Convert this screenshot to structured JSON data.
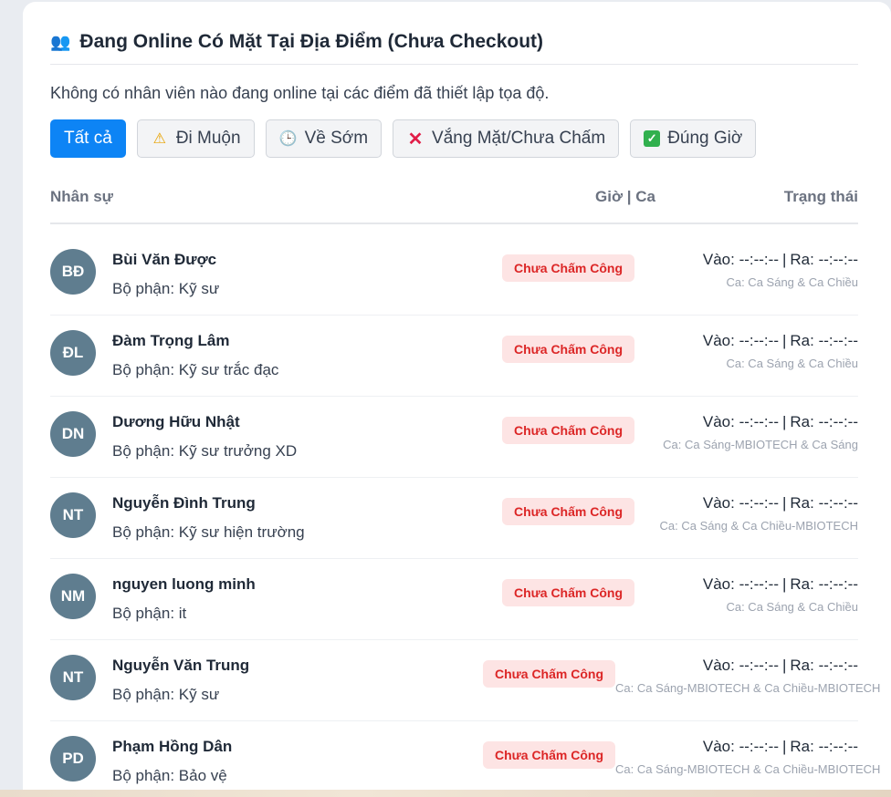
{
  "header": {
    "icon": "people-icon",
    "title": "Đang Online Có Mặt Tại Địa Điểm (Chưa Checkout)"
  },
  "empty_message": "Không có nhân viên nào đang online tại các điểm đã thiết lập tọa độ.",
  "filters": [
    {
      "label": "Tất cả",
      "icon": "",
      "active": true
    },
    {
      "label": "Đi Muộn",
      "icon": "warning-icon",
      "active": false
    },
    {
      "label": "Về Sớm",
      "icon": "clock-icon",
      "active": false
    },
    {
      "label": "Vắng Mặt/Chưa Chấm",
      "icon": "cross-icon",
      "active": false
    },
    {
      "label": "Đúng Giờ",
      "icon": "check-icon",
      "active": false
    }
  ],
  "table": {
    "headers": {
      "name": "Nhân sự",
      "time": "Giờ | Ca",
      "status": "Trạng thái"
    },
    "rows": [
      {
        "initials": "BĐ",
        "name": "Bùi Văn Được",
        "dept": "Bộ phận: Kỹ sư",
        "status": "Chưa Chấm Công",
        "in": "Vào: --:--:--",
        "out": "Ra: --:--:--",
        "shift": "Ca: Ca Sáng & Ca Chiều"
      },
      {
        "initials": "ĐL",
        "name": "Đàm Trọng Lâm",
        "dept": "Bộ phận: Kỹ sư trắc đạc",
        "status": "Chưa Chấm Công",
        "in": "Vào: --:--:--",
        "out": "Ra: --:--:--",
        "shift": "Ca: Ca Sáng & Ca Chiều"
      },
      {
        "initials": "DN",
        "name": "Dương Hữu Nhật",
        "dept": "Bộ phận: Kỹ sư trưởng XD",
        "status": "Chưa Chấm Công",
        "in": "Vào: --:--:--",
        "out": "Ra: --:--:--",
        "shift": "Ca: Ca Sáng-MBIOTECH & Ca Sáng"
      },
      {
        "initials": "NT",
        "name": "Nguyễn Đình Trung",
        "dept": "Bộ phận: Kỹ sư hiện trường",
        "status": "Chưa Chấm Công",
        "in": "Vào: --:--:--",
        "out": "Ra: --:--:--",
        "shift": "Ca: Ca Sáng & Ca Chiều-MBIOTECH"
      },
      {
        "initials": "NM",
        "name": "nguyen luong minh",
        "dept": "Bộ phận: it",
        "status": "Chưa Chấm Công",
        "in": "Vào: --:--:--",
        "out": "Ra: --:--:--",
        "shift": "Ca: Ca Sáng & Ca Chiều"
      },
      {
        "initials": "NT",
        "name": "Nguyễn Văn Trung",
        "dept": "Bộ phận: Kỹ sư",
        "status": "Chưa Chấm Công",
        "in": "Vào: --:--:--",
        "out": "Ra: --:--:--",
        "shift": "Ca: Ca Sáng-MBIOTECH & Ca Chiều-MBIOTECH"
      },
      {
        "initials": "PD",
        "name": "Phạm Hồng Dân",
        "dept": "Bộ phận: Bảo vệ",
        "status": "Chưa Chấm Công",
        "in": "Vào: --:--:--",
        "out": "Ra: --:--:--",
        "shift": "Ca: Ca Sáng-MBIOTECH & Ca Chiều-MBIOTECH"
      }
    ]
  },
  "colors": {
    "accent": "#0d84f5",
    "badge_bg": "#fde4e4",
    "badge_text": "#dc2626",
    "avatar_bg": "#5f7d8f"
  }
}
